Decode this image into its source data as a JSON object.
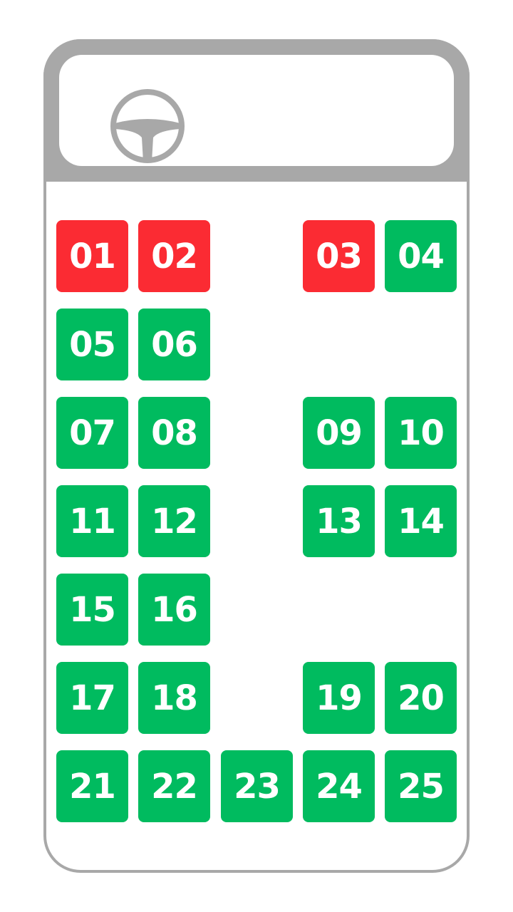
{
  "colors": {
    "available": "#00bb5f",
    "booked": "#fb2b33",
    "frame": "#a8a8a8"
  },
  "driver": {
    "icon": "steering-wheel-icon"
  },
  "seats": [
    {
      "label": "01",
      "status": "booked"
    },
    {
      "label": "02",
      "status": "booked"
    },
    {
      "label": "03",
      "status": "booked"
    },
    {
      "label": "04",
      "status": "available"
    },
    {
      "label": "05",
      "status": "available"
    },
    {
      "label": "06",
      "status": "available"
    },
    {
      "label": "07",
      "status": "available"
    },
    {
      "label": "08",
      "status": "available"
    },
    {
      "label": "09",
      "status": "available"
    },
    {
      "label": "10",
      "status": "available"
    },
    {
      "label": "11",
      "status": "available"
    },
    {
      "label": "12",
      "status": "available"
    },
    {
      "label": "13",
      "status": "available"
    },
    {
      "label": "14",
      "status": "available"
    },
    {
      "label": "15",
      "status": "available"
    },
    {
      "label": "16",
      "status": "available"
    },
    {
      "label": "17",
      "status": "available"
    },
    {
      "label": "18",
      "status": "available"
    },
    {
      "label": "19",
      "status": "available"
    },
    {
      "label": "20",
      "status": "available"
    },
    {
      "label": "21",
      "status": "available"
    },
    {
      "label": "22",
      "status": "available"
    },
    {
      "label": "23",
      "status": "available"
    },
    {
      "label": "24",
      "status": "available"
    },
    {
      "label": "25",
      "status": "available"
    }
  ]
}
